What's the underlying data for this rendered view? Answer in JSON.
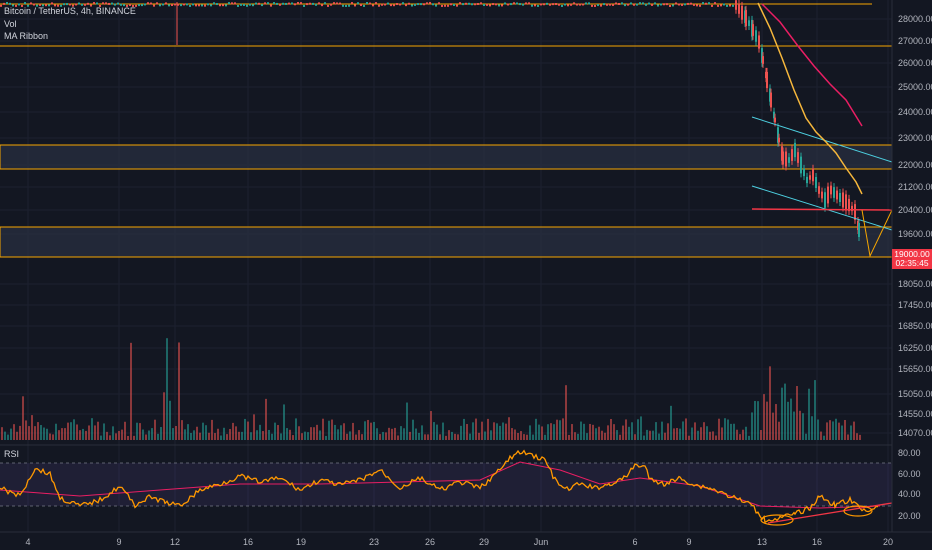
{
  "legend": {
    "symbol": "Bitcoin / TetherUS, 4h, BINANCE",
    "vol": "Vol",
    "ma": "MA Ribbon"
  },
  "rsi_label": "RSI",
  "price_axis": [
    "28000.00",
    "27000.00",
    "26000.00",
    "25000.00",
    "24000.00",
    "23000.00",
    "22000.00",
    "21200.00",
    "20400.00",
    "19600.00",
    "18050.00",
    "17450.00",
    "16850.00",
    "16250.00",
    "15650.00",
    "15050.00",
    "14550.00",
    "14070.00"
  ],
  "rsi_axis": [
    "80.00",
    "60.00",
    "40.00",
    "20.00"
  ],
  "time_axis": [
    "4",
    "9",
    "12",
    "16",
    "19",
    "23",
    "26",
    "29",
    "Jun",
    "6",
    "9",
    "13",
    "16",
    "20"
  ],
  "last_price": {
    "price": "19000.00",
    "countdown": "02:35:45"
  },
  "colors": {
    "bg": "#131722",
    "up": "#26a69a",
    "down": "#ef5350",
    "support": "#f7a600",
    "channel": "#4dd0e1",
    "ma_fast": "#f6b73c",
    "ma_slow": "#e91e63",
    "rsi": "#ff9800",
    "rsi_ma": "#e91e63"
  }
}
